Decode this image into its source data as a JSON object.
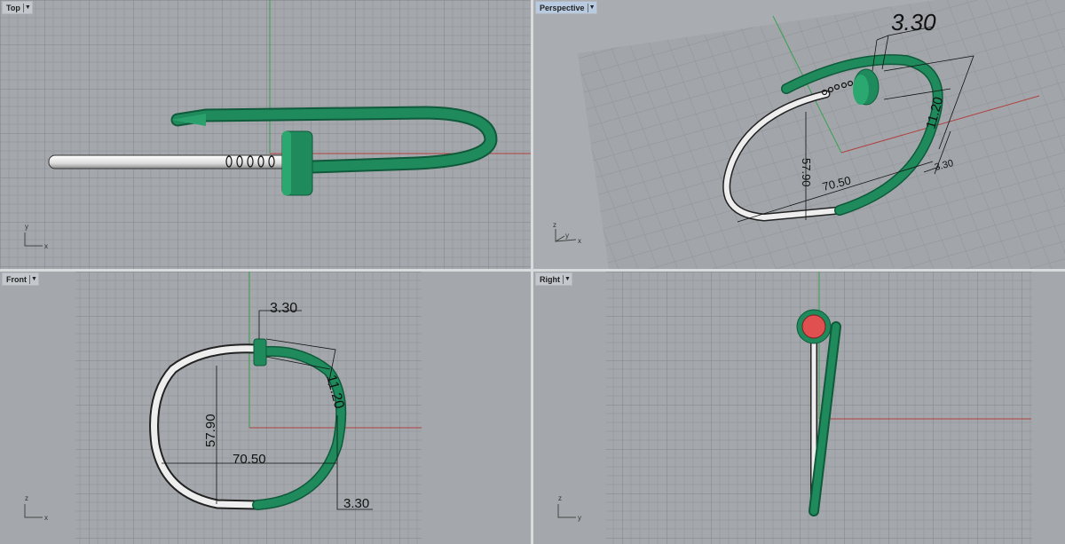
{
  "viewports": {
    "top": {
      "label": "Top",
      "axes": [
        "y",
        "x"
      ]
    },
    "perspective": {
      "label": "Perspective",
      "axes": [
        "z",
        "y",
        "x"
      ]
    },
    "front": {
      "label": "Front",
      "axes": [
        "z",
        "x"
      ]
    },
    "right": {
      "label": "Right",
      "axes": [
        "z",
        "y"
      ]
    }
  },
  "dimensions": {
    "collar_width": "3.30",
    "gap": "11.20",
    "height": "57.90",
    "width": "70.50",
    "thickness": "3.30"
  },
  "colors": {
    "background": "#a4a8ac",
    "grid_minor": "#989ca1",
    "grid_major": "#888c91",
    "x_axis": "#b04040",
    "y_axis": "#3aa050",
    "green_part": "#1f8a5c",
    "silver_part": "#ececec",
    "cap_red": "#e05050",
    "active_label": "#b9cbe0"
  },
  "dropdown_icon": "caret-down-icon"
}
